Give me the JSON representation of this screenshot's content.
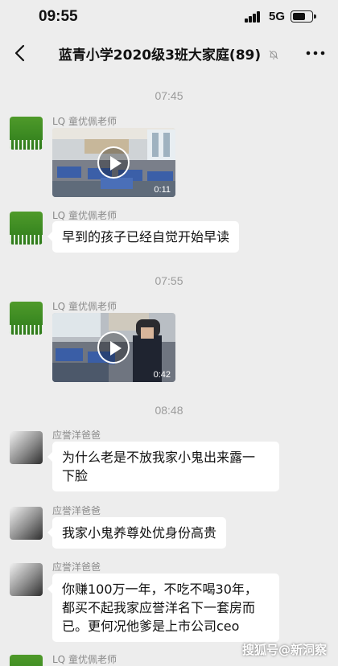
{
  "status_bar": {
    "time": "09:55",
    "network": "5G",
    "battery_level": 0.7
  },
  "nav": {
    "title": "蓝青小学2020级3班大家庭(89)",
    "back_icon": "chevron-left-icon",
    "mute_icon": "bell-off-icon",
    "more_icon": "more-dots-icon"
  },
  "messages": {
    "ts1": "07:45",
    "m1": {
      "sender": "LQ 童优佩老师",
      "duration": "0:11"
    },
    "m2": {
      "sender": "LQ 童优佩老师",
      "text": "早到的孩子已经自觉开始早读"
    },
    "ts2": "07:55",
    "m3": {
      "sender": "LQ 童优佩老师",
      "duration": "0:42"
    },
    "ts3": "08:48",
    "m4": {
      "sender": "应誉洋爸爸",
      "line1": "为什么老是不放我家小鬼出来露一",
      "line2": "下脸"
    },
    "m5": {
      "sender": "应誉洋爸爸",
      "text": "我家小鬼养尊处优身份高贵"
    },
    "m6": {
      "sender": "应誉洋爸爸",
      "line1": "你赚100万一年，不吃不喝30年，",
      "line2": "都买不起我家应誉洋名下一套房而",
      "line3": "已。更何况他爹是上市公司ceo"
    },
    "m7": {
      "sender": "LQ 童优佩老师"
    }
  },
  "watermark": "搜狐号@新洞察",
  "colors": {
    "chat_bg": "#ededed",
    "bubble_bg": "#ffffff",
    "timestamp": "#9b9b9b"
  }
}
